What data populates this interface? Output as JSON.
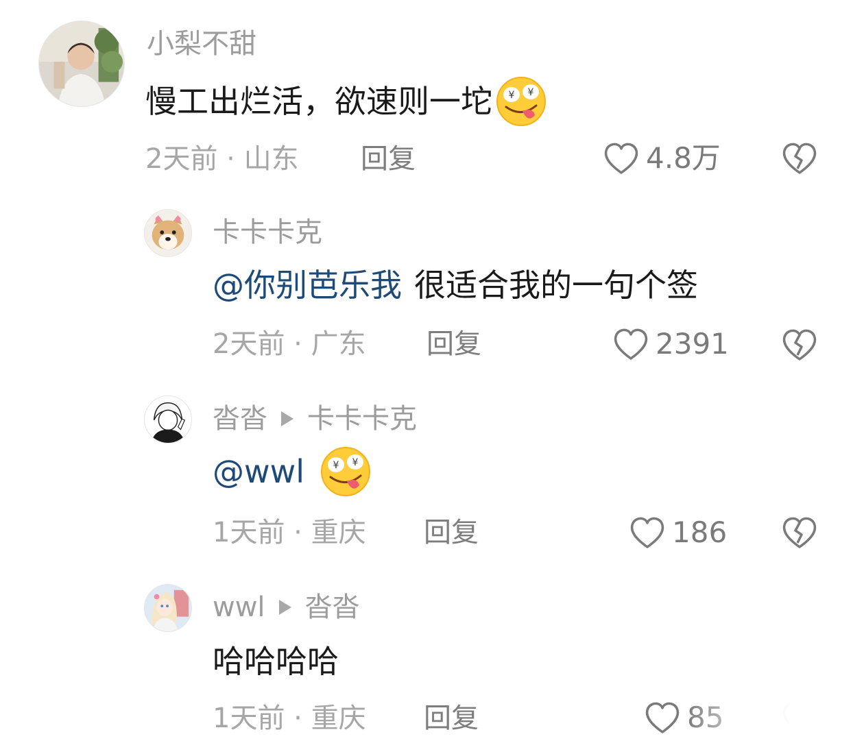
{
  "comments": [
    {
      "username": "小梨不甜",
      "text": "慢工出烂活，欲速则一坨",
      "meta": "2天前 · 山东",
      "reply_label": "回复",
      "likes": "4.8万"
    },
    {
      "username": "卡卡卡克",
      "mention": "@你别芭乐我",
      "text": "很适合我的一句个签",
      "meta": "2天前 · 广东",
      "reply_label": "回复",
      "likes": "2391"
    },
    {
      "username": "沓沓",
      "reply_to": "卡卡卡克",
      "mention": "@wwl",
      "meta": "1天前 · 重庆",
      "reply_label": "回复",
      "likes": "186"
    },
    {
      "username": "wwl",
      "reply_to": "沓沓",
      "text": "哈哈哈哈",
      "meta": "1天前 · 重庆",
      "reply_label": "回复",
      "likes": "85"
    }
  ],
  "icons": {
    "like": "heart-outline-icon",
    "dislike": "broken-heart-icon",
    "reply_arrow": "triangle-right-icon",
    "emoji": "money-eyes-tongue-emoji"
  },
  "colors": {
    "mention": "#1e4a78",
    "username": "#9c9c9c",
    "body_text": "#1a1a1a"
  }
}
